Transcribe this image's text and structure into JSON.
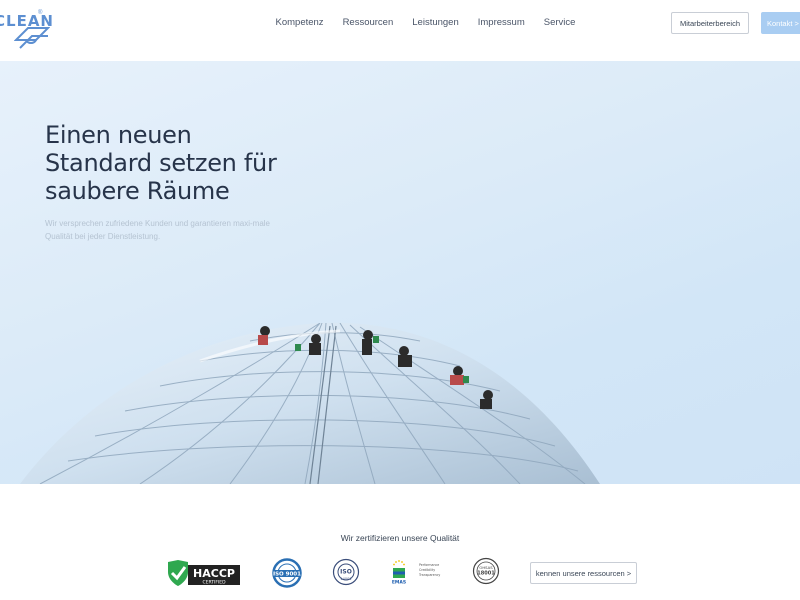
{
  "header": {
    "logo_text": "CLEAN",
    "logo_registered": "®",
    "nav": [
      "Kompetenz",
      "Ressourcen",
      "Leistungen",
      "Impressum",
      "Service"
    ],
    "staff_button": "Mitarbeiterbereich",
    "contact_button": "Kontakt >"
  },
  "hero": {
    "title_lines": [
      "Einen neuen",
      "Standard setzen für",
      "saubere Räume"
    ],
    "subtitle": "Wir versprechen zufriedene Kunden und garantieren maxi-male Qualität bei jeder Dienstleistung.",
    "image_icon": "glass-dome-window-cleaners-image"
  },
  "certifications": {
    "heading": "Wir zertifizieren unsere Qualität",
    "badges": [
      {
        "icon": "haccp-icon",
        "label": "HACCP",
        "sub": "CERTIFIED"
      },
      {
        "icon": "iso-9001-icon",
        "label": "ISO 9001"
      },
      {
        "icon": "iso-14001-icon",
        "label": "ISO",
        "sub": "14001"
      },
      {
        "icon": "emas-icon",
        "label": "EMAS",
        "sub": "Performance Credibility Transparency"
      },
      {
        "icon": "ohsas-18001-icon",
        "label": "OHSAS",
        "sub": "18001"
      }
    ],
    "resources_button": "kennen unsere ressourcen >"
  },
  "colors": {
    "accent": "#a9cdf2",
    "brand": "#5d8fd1",
    "title": "#27344a",
    "haccp_green": "#2fa84f"
  }
}
